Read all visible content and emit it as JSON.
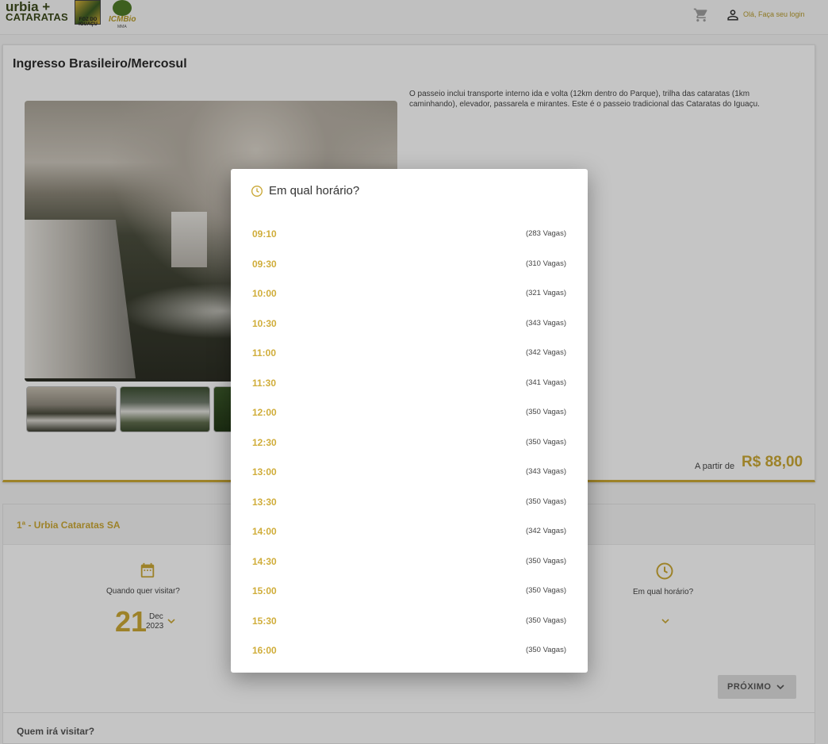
{
  "header": {
    "brand_line1": "urbia +",
    "brand_line2": "CATARATAS",
    "foz_caption": "FOZ DO IGUAÇU",
    "icmbio_text": "ICMBio",
    "icmbio_sub": "MMA",
    "login_text": "Olá, Faça seu login"
  },
  "product": {
    "title": "Ingresso Brasileiro/Mercosul",
    "description": "O passeio inclui transporte interno ida e volta (12km dentro do Parque), trilha das cataratas (1km caminhando), elevador, passarela e mirantes. Este é o passeio tradicional das Cataratas do Iguaçu.",
    "price_label": "A partir de",
    "price": "R$ 88,00"
  },
  "booking": {
    "step_title": "1ª - Urbia Cataratas SA",
    "visit_label": "Quando quer visitar?",
    "day": "21",
    "month": "Dec",
    "year": "2023",
    "time_label": "Em qual horário?",
    "next_label": "PRÓXIMO",
    "who_label": "Quem irá visitar?"
  },
  "modal": {
    "title": "Em qual horário?",
    "slots": [
      {
        "time": "09:10",
        "vagas": "(283 Vagas)"
      },
      {
        "time": "09:30",
        "vagas": "(310 Vagas)"
      },
      {
        "time": "10:00",
        "vagas": "(321 Vagas)"
      },
      {
        "time": "10:30",
        "vagas": "(343 Vagas)"
      },
      {
        "time": "11:00",
        "vagas": "(342 Vagas)"
      },
      {
        "time": "11:30",
        "vagas": "(341 Vagas)"
      },
      {
        "time": "12:00",
        "vagas": "(350 Vagas)"
      },
      {
        "time": "12:30",
        "vagas": "(350 Vagas)"
      },
      {
        "time": "13:00",
        "vagas": "(343 Vagas)"
      },
      {
        "time": "13:30",
        "vagas": "(350 Vagas)"
      },
      {
        "time": "14:00",
        "vagas": "(342 Vagas)"
      },
      {
        "time": "14:30",
        "vagas": "(350 Vagas)"
      },
      {
        "time": "15:00",
        "vagas": "(350 Vagas)"
      },
      {
        "time": "15:30",
        "vagas": "(350 Vagas)"
      },
      {
        "time": "16:00",
        "vagas": "(350 Vagas)"
      }
    ]
  },
  "icons": {
    "cart": "cart-icon",
    "user": "user-icon",
    "calendar": "calendar-icon",
    "clock": "clock-icon",
    "chevron": "chevron-down-icon"
  },
  "colors": {
    "accent": "#c9a735",
    "brand_green": "#3c4a1c",
    "overlay": "rgba(0,0,0,0.22)"
  }
}
